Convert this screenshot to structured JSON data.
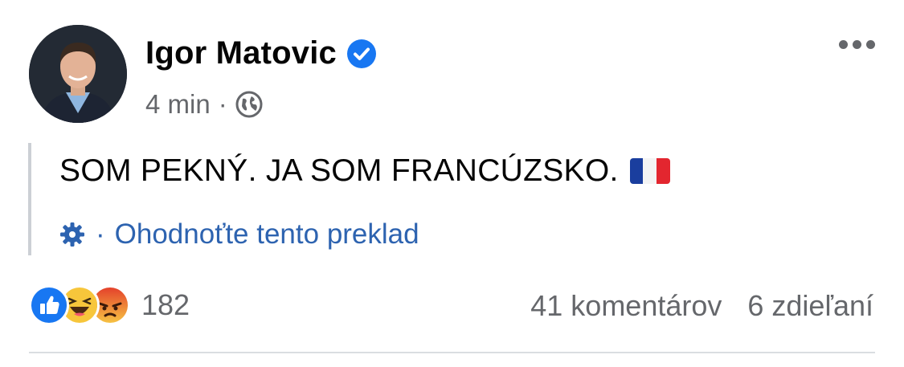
{
  "post": {
    "author": "Igor Matovic",
    "time": "4 min",
    "separator": "·",
    "text": "SOM PEKNÝ. JA SOM FRANCÚZSKO.",
    "translate_separator": "·",
    "translate_link": "Ohodnoťte tento preklad",
    "reactions_count": "182",
    "comments": "41 komentárov",
    "shares": "6 zdieľaní"
  },
  "icons": {
    "verified": "verified-badge-icon",
    "audience": "globe-icon",
    "more": "more-options-icon",
    "translate": "gear-icon",
    "flag": "france-flag-icon",
    "reactions": [
      "like-icon",
      "haha-icon",
      "angry-icon"
    ]
  },
  "colors": {
    "verified_blue": "#1877f2",
    "link_blue": "#2d63b0",
    "secondary_text": "#65676b"
  }
}
